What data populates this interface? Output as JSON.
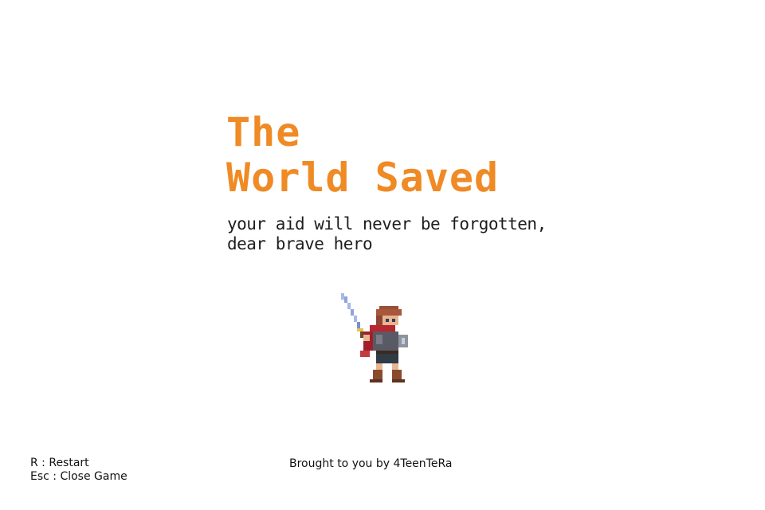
{
  "title": {
    "line1": "The",
    "line2": "World Saved"
  },
  "subtitle": {
    "line1": "your aid will never be forgotten,",
    "line2": "dear brave hero"
  },
  "hero_sprite": {
    "icon": "sword-hero-icon"
  },
  "controls": {
    "restart": "R : Restart",
    "close_game": "Esc : Close Game"
  },
  "credits": "Brought to you by 4TeenTeRa",
  "colors": {
    "title": "#ef8a25",
    "text": "#1e1e1e",
    "background": "#ffffff"
  }
}
